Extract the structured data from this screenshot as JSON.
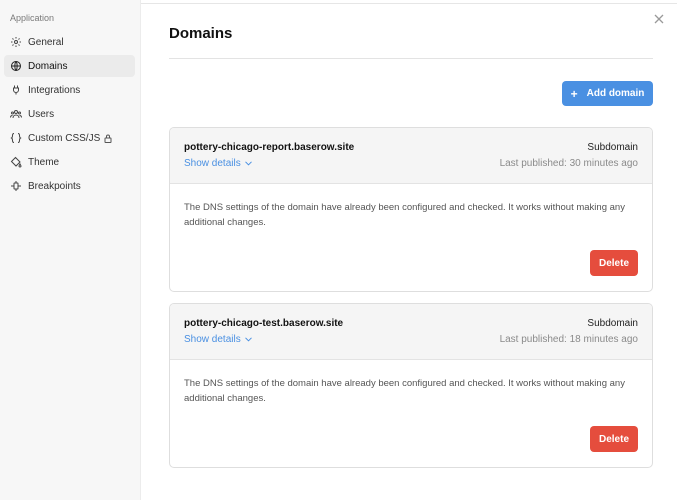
{
  "sidebar": {
    "title": "Application",
    "items": [
      {
        "label": "General",
        "icon": "gear-icon"
      },
      {
        "label": "Domains",
        "icon": "globe-icon",
        "active": true
      },
      {
        "label": "Integrations",
        "icon": "plug-icon"
      },
      {
        "label": "Users",
        "icon": "users-icon"
      },
      {
        "label": "Custom CSS/JS",
        "icon": "braces-icon",
        "locked": true
      },
      {
        "label": "Theme",
        "icon": "paint-bucket-icon"
      },
      {
        "label": "Breakpoints",
        "icon": "breakpoints-icon"
      }
    ]
  },
  "main": {
    "title": "Domains",
    "add_button": "Add domain",
    "domains": [
      {
        "name": "pottery-chicago-report.baserow.site",
        "type": "Subdomain",
        "show_details": "Show details",
        "published": "Last published: 30 minutes ago",
        "message": "The DNS settings of the domain have already been configured and checked. It works without making any additional changes.",
        "delete": "Delete"
      },
      {
        "name": "pottery-chicago-test.baserow.site",
        "type": "Subdomain",
        "show_details": "Show details",
        "published": "Last published: 18 minutes ago",
        "message": "The DNS settings of the domain have already been configured and checked. It works without making any additional changes.",
        "delete": "Delete"
      }
    ]
  },
  "colors": {
    "accent": "#4a90e2",
    "danger": "#e54d3d"
  }
}
